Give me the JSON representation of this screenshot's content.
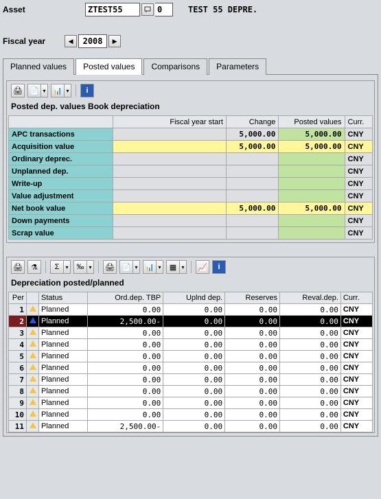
{
  "header": {
    "asset_label": "Asset",
    "asset_value": "ZTEST55",
    "asset_sub": "0",
    "asset_desc": "TEST 55 DEPRE.",
    "fiscal_label": "Fiscal year",
    "fiscal_value": "2008"
  },
  "tabs": [
    "Planned values",
    "Posted values",
    "Comparisons",
    "Parameters"
  ],
  "active_tab": 1,
  "posted": {
    "title": "Posted dep. values Book depreciation",
    "headers": [
      "",
      "Fiscal year start",
      "Change",
      "Posted values",
      "Curr."
    ],
    "rows": [
      {
        "label": "APC transactions",
        "fys": "",
        "change": "5,000.00",
        "posted": "5,000.00",
        "curr": "CNY",
        "yellow": false
      },
      {
        "label": "Acquisition value",
        "fys": "",
        "change": "5,000.00",
        "posted": "5,000.00",
        "curr": "CNY",
        "yellow": true
      },
      {
        "label": "Ordinary deprec.",
        "fys": "",
        "change": "",
        "posted": "",
        "curr": "CNY",
        "yellow": false
      },
      {
        "label": "Unplanned dep.",
        "fys": "",
        "change": "",
        "posted": "",
        "curr": "CNY",
        "yellow": false
      },
      {
        "label": "Write-up",
        "fys": "",
        "change": "",
        "posted": "",
        "curr": "CNY",
        "yellow": false
      },
      {
        "label": "Value adjustment",
        "fys": "",
        "change": "",
        "posted": "",
        "curr": "CNY",
        "yellow": false
      },
      {
        "label": "Net book value",
        "fys": "",
        "change": "5,000.00",
        "posted": "5,000.00",
        "curr": "CNY",
        "yellow": true
      },
      {
        "label": "Down payments",
        "fys": "",
        "change": "",
        "posted": "",
        "curr": "CNY",
        "yellow": false
      },
      {
        "label": "Scrap value",
        "fys": "",
        "change": "",
        "posted": "",
        "curr": "CNY",
        "yellow": false
      }
    ]
  },
  "dep": {
    "title": "Depreciation posted/planned",
    "headers": [
      "Per",
      "",
      "Status",
      "Ord.dep. TBP",
      "Uplnd dep.",
      "Reserves",
      "Reval.dep.",
      "Curr."
    ],
    "rows": [
      {
        "per": "1",
        "sel": false,
        "status": "Planned",
        "ord": "0.00",
        "upl": "0.00",
        "res": "0.00",
        "rev": "0.00",
        "curr": "CNY"
      },
      {
        "per": "2",
        "sel": true,
        "status": "Planned",
        "ord": "2,500.00-",
        "upl": "0.00",
        "res": "0.00",
        "rev": "0.00",
        "curr": "CNY"
      },
      {
        "per": "3",
        "sel": false,
        "status": "Planned",
        "ord": "0.00",
        "upl": "0.00",
        "res": "0.00",
        "rev": "0.00",
        "curr": "CNY"
      },
      {
        "per": "4",
        "sel": false,
        "status": "Planned",
        "ord": "0.00",
        "upl": "0.00",
        "res": "0.00",
        "rev": "0.00",
        "curr": "CNY"
      },
      {
        "per": "5",
        "sel": false,
        "status": "Planned",
        "ord": "0.00",
        "upl": "0.00",
        "res": "0.00",
        "rev": "0.00",
        "curr": "CNY"
      },
      {
        "per": "6",
        "sel": false,
        "status": "Planned",
        "ord": "0.00",
        "upl": "0.00",
        "res": "0.00",
        "rev": "0.00",
        "curr": "CNY"
      },
      {
        "per": "7",
        "sel": false,
        "status": "Planned",
        "ord": "0.00",
        "upl": "0.00",
        "res": "0.00",
        "rev": "0.00",
        "curr": "CNY"
      },
      {
        "per": "8",
        "sel": false,
        "status": "Planned",
        "ord": "0.00",
        "upl": "0.00",
        "res": "0.00",
        "rev": "0.00",
        "curr": "CNY"
      },
      {
        "per": "9",
        "sel": false,
        "status": "Planned",
        "ord": "0.00",
        "upl": "0.00",
        "res": "0.00",
        "rev": "0.00",
        "curr": "CNY"
      },
      {
        "per": "10",
        "sel": false,
        "status": "Planned",
        "ord": "0.00",
        "upl": "0.00",
        "res": "0.00",
        "rev": "0.00",
        "curr": "CNY"
      },
      {
        "per": "11",
        "sel": false,
        "status": "Planned",
        "ord": "2,500.00-",
        "upl": "0.00",
        "res": "0.00",
        "rev": "0.00",
        "curr": "CNY"
      }
    ]
  }
}
